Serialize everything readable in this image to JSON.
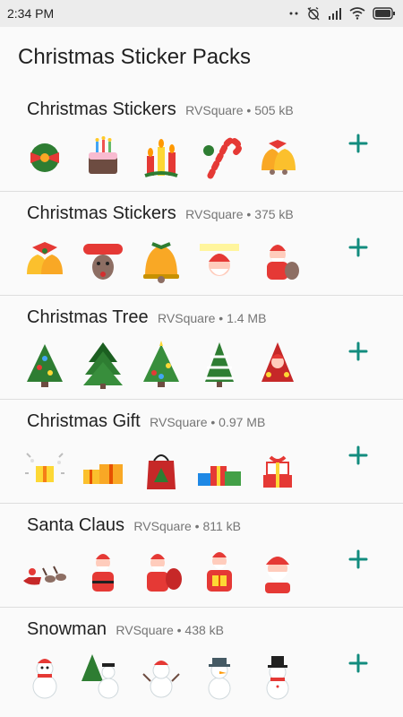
{
  "status_bar": {
    "time": "2:34 PM",
    "icons": [
      "signal-dots-icon",
      "alarm-off-icon",
      "cell-signal-icon",
      "wifi-icon",
      "battery-icon"
    ]
  },
  "page": {
    "title": "Christmas Sticker Packs"
  },
  "colors": {
    "accent": "#128c7e",
    "divider": "#dedede",
    "background": "#fafafa"
  },
  "packs": [
    {
      "name": "Christmas Stickers",
      "publisher": "RVSquare",
      "size": "505 kB",
      "separator": "•",
      "stickers": [
        "holly-bow-sticker",
        "birthday-cake-sticker",
        "candles-sticker",
        "candy-cane-sticker",
        "jingle-bells-sticker"
      ]
    },
    {
      "name": "Christmas Stickers",
      "publisher": "RVSquare",
      "size": "375 kB",
      "separator": "•",
      "stickers": [
        "bells-bow-sticker",
        "merry-christmas-reindeer-sticker",
        "golden-bell-sticker",
        "santa-on-my-way-sticker",
        "santa-sack-sticker"
      ]
    },
    {
      "name": "Christmas Tree",
      "publisher": "RVSquare",
      "size": "1.4 MB",
      "separator": "•",
      "stickers": [
        "tree-ornaments-sticker",
        "green-tree-sticker",
        "decorated-tree-sticker",
        "snowy-tree-sticker",
        "santa-tree-sticker"
      ]
    },
    {
      "name": "Christmas Gift",
      "publisher": "RVSquare",
      "size": "0.97 MB",
      "separator": "•",
      "stickers": [
        "sparkle-gift-sticker",
        "gold-gifts-sticker",
        "red-gift-bag-sticker",
        "gift-pile-sticker",
        "gift-stack-sticker"
      ]
    },
    {
      "name": "Santa Claus",
      "publisher": "RVSquare",
      "size": "811 kB",
      "separator": "•",
      "stickers": [
        "sleigh-reindeer-sticker",
        "santa-waving-sticker",
        "santa-bag-sticker",
        "santa-presents-sticker",
        "santa-face-sticker"
      ]
    },
    {
      "name": "Snowman",
      "publisher": "RVSquare",
      "size": "438 kB",
      "separator": "•",
      "stickers": [
        "snowman-scarf-sticker",
        "snowman-tree-sticker",
        "snowman-waving-sticker",
        "snowman-hat-sticker",
        "snowman-tophat-sticker"
      ]
    }
  ]
}
